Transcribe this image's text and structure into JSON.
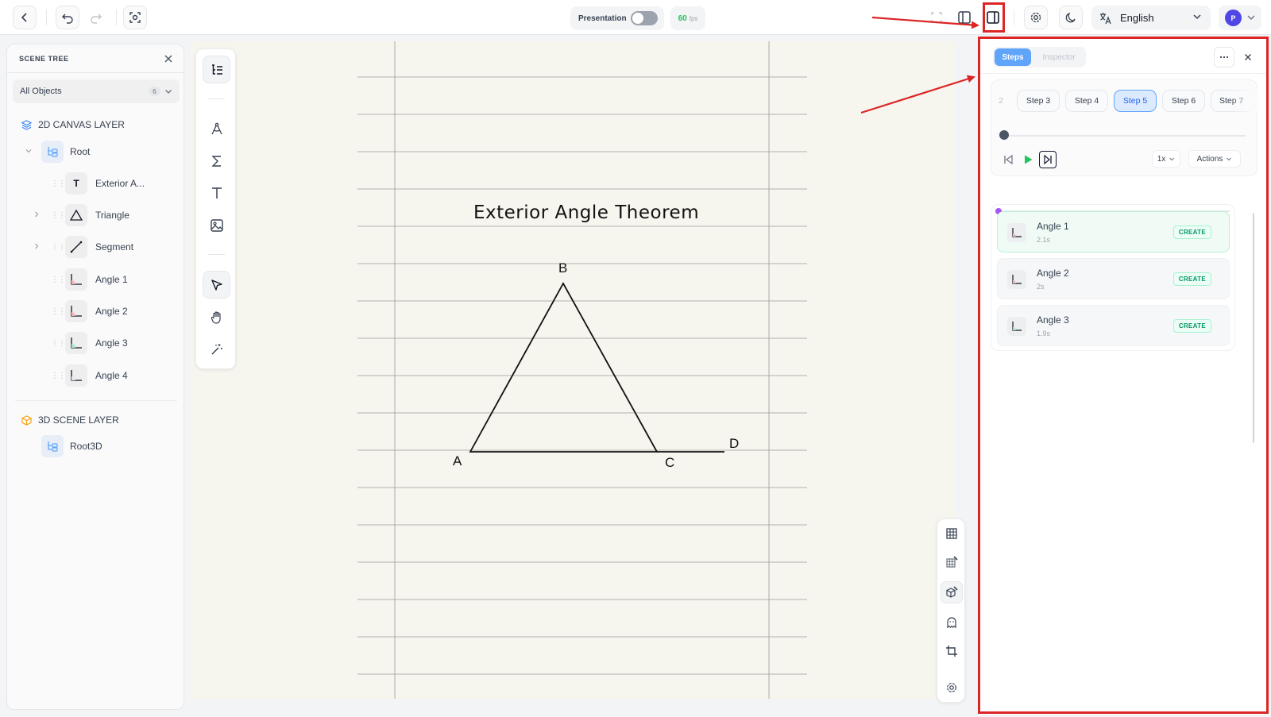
{
  "topbar": {
    "presentation_label": "Presentation",
    "fps_value": "60",
    "fps_unit": "fps",
    "language": "English",
    "avatar_initial": "P"
  },
  "scene_tree": {
    "title": "SCENE TREE",
    "filter_label": "All Objects",
    "filter_count": "6",
    "layer_2d": "2D CANVAS LAYER",
    "layer_3d": "3D SCENE LAYER",
    "root": "Root",
    "root3d": "Root3D",
    "items": [
      {
        "label": "Exterior A...",
        "icon": "text-icon"
      },
      {
        "label": "Triangle",
        "icon": "triangle-icon"
      },
      {
        "label": "Segment",
        "icon": "segment-icon"
      },
      {
        "label": "Angle 1",
        "icon": "angle-icon"
      },
      {
        "label": "Angle 2",
        "icon": "angle-icon"
      },
      {
        "label": "Angle 3",
        "icon": "angle-icon"
      },
      {
        "label": "Angle 4",
        "icon": "angle-icon"
      }
    ]
  },
  "canvas": {
    "title": "Exterior Angle Theorem",
    "points": {
      "a": "A",
      "b": "B",
      "c": "C",
      "d": "D"
    }
  },
  "panel": {
    "tab_steps": "Steps",
    "tab_inspector": "Inspector",
    "steps": [
      "2",
      "Step 3",
      "Step 4",
      "Step 5",
      "Step 6",
      "Step 7"
    ],
    "active_step": "Step 5",
    "speed": "1x",
    "actions": "Actions",
    "items": [
      {
        "name": "Angle 1",
        "duration": "2.1s",
        "action": "CREATE"
      },
      {
        "name": "Angle 2",
        "duration": "2s",
        "action": "CREATE"
      },
      {
        "name": "Angle 3",
        "duration": "1.9s",
        "action": "CREATE"
      }
    ]
  },
  "colors": {
    "accent": "#60a5fa",
    "annotation": "#dc2626",
    "success": "#22c55e"
  }
}
